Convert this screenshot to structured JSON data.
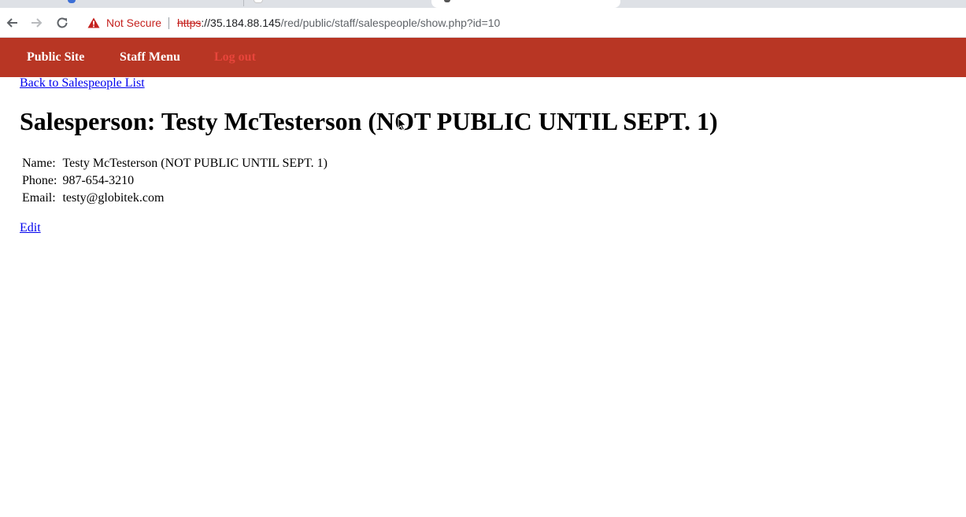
{
  "browser": {
    "security_label": "Not Secure",
    "url_scheme": "https",
    "url_host": "://35.184.88.145",
    "url_path": "/red/public/staff/salespeople/show.php?id=10"
  },
  "nav": {
    "public_site": "Public Site",
    "staff_menu": "Staff Menu",
    "logout": "Log out"
  },
  "page": {
    "back_link": "Back to Salespeople List",
    "title": "Salesperson: Testy McTesterson (NOT PUBLIC UNTIL SEPT. 1)",
    "details": [
      {
        "label": "Name:",
        "value": "Testy McTesterson (NOT PUBLIC UNTIL SEPT. 1)"
      },
      {
        "label": "Phone:",
        "value": "987-654-3210"
      },
      {
        "label": "Email:",
        "value": "testy@globitek.com"
      }
    ],
    "edit_link": "Edit"
  },
  "colors": {
    "header_bg": "#b83624",
    "logout_link": "#e8453b",
    "link": "#0000ee",
    "warning": "#c5221f"
  },
  "icons": [
    "back-arrow-icon",
    "forward-arrow-icon",
    "reload-icon",
    "warning-icon",
    "mouse-cursor-icon"
  ]
}
